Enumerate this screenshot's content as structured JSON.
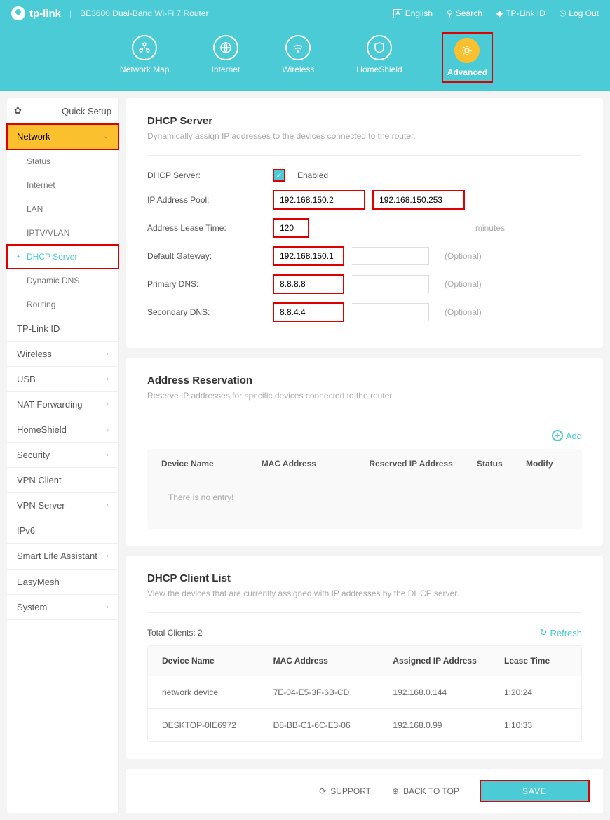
{
  "header": {
    "brand": "tp-link",
    "model": "BE3600 Dual-Band Wi-Fi 7 Router",
    "links": {
      "lang": "English",
      "search": "Search",
      "id": "TP-Link ID",
      "logout": "Log Out"
    }
  },
  "nav": {
    "items": [
      {
        "label": "Network Map"
      },
      {
        "label": "Internet"
      },
      {
        "label": "Wireless"
      },
      {
        "label": "HomeShield"
      },
      {
        "label": "Advanced"
      }
    ]
  },
  "sidebar": {
    "quick": "Quick Setup",
    "network": "Network",
    "subs": {
      "status": "Status",
      "internet": "Internet",
      "lan": "LAN",
      "iptv": "IPTV/VLAN",
      "dhcp": "DHCP Server",
      "ddns": "Dynamic DNS",
      "routing": "Routing"
    },
    "items": {
      "tplinkid": "TP-Link ID",
      "wireless": "Wireless",
      "usb": "USB",
      "nat": "NAT Forwarding",
      "homeshield": "HomeShield",
      "security": "Security",
      "vpnclient": "VPN Client",
      "vpnserver": "VPN Server",
      "ipv6": "IPv6",
      "smartlife": "Smart Life Assistant",
      "easymesh": "EasyMesh",
      "system": "System"
    }
  },
  "dhcp": {
    "title": "DHCP Server",
    "desc": "Dynamically assign IP addresses to the devices connected to the router.",
    "labels": {
      "server": "DHCP Server:",
      "pool": "IP Address Pool:",
      "lease": "Address Lease Time:",
      "gateway": "Default Gateway:",
      "pdns": "Primary DNS:",
      "sdns": "Secondary DNS:"
    },
    "enabled": "Enabled",
    "pool_start": "192.168.150.2",
    "pool_end": "192.168.150.253",
    "lease": "120",
    "lease_unit": "minutes",
    "gateway": "192.168.150.1",
    "pdns": "8.8.8.8",
    "sdns": "8.8.4.4",
    "optional": "(Optional)"
  },
  "reservation": {
    "title": "Address Reservation",
    "desc": "Reserve IP addresses for specific devices connected to the router.",
    "add": "Add",
    "headers": {
      "device": "Device Name",
      "mac": "MAC Address",
      "ip": "Reserved IP Address",
      "status": "Status",
      "modify": "Modify"
    },
    "empty": "There is no entry!"
  },
  "clients": {
    "title": "DHCP Client List",
    "desc": "View the devices that are currently assigned with IP addresses by the DHCP server.",
    "total_label": "Total Clients: ",
    "total": "2",
    "refresh": "Refresh",
    "headers": {
      "device": "Device Name",
      "mac": "MAC Address",
      "ip": "Assigned IP Address",
      "lease": "Lease Time"
    },
    "rows": [
      {
        "device": "network device",
        "mac": "7E-04-E5-3F-6B-CD",
        "ip": "192.168.0.144",
        "lease": "1:20:24"
      },
      {
        "device": "DESKTOP-0IE6972",
        "mac": "D8-BB-C1-6C-E3-06",
        "ip": "192.168.0.99",
        "lease": "1:10:33"
      }
    ]
  },
  "footer": {
    "support": "SUPPORT",
    "backtotop": "BACK TO TOP",
    "save": "SAVE"
  }
}
